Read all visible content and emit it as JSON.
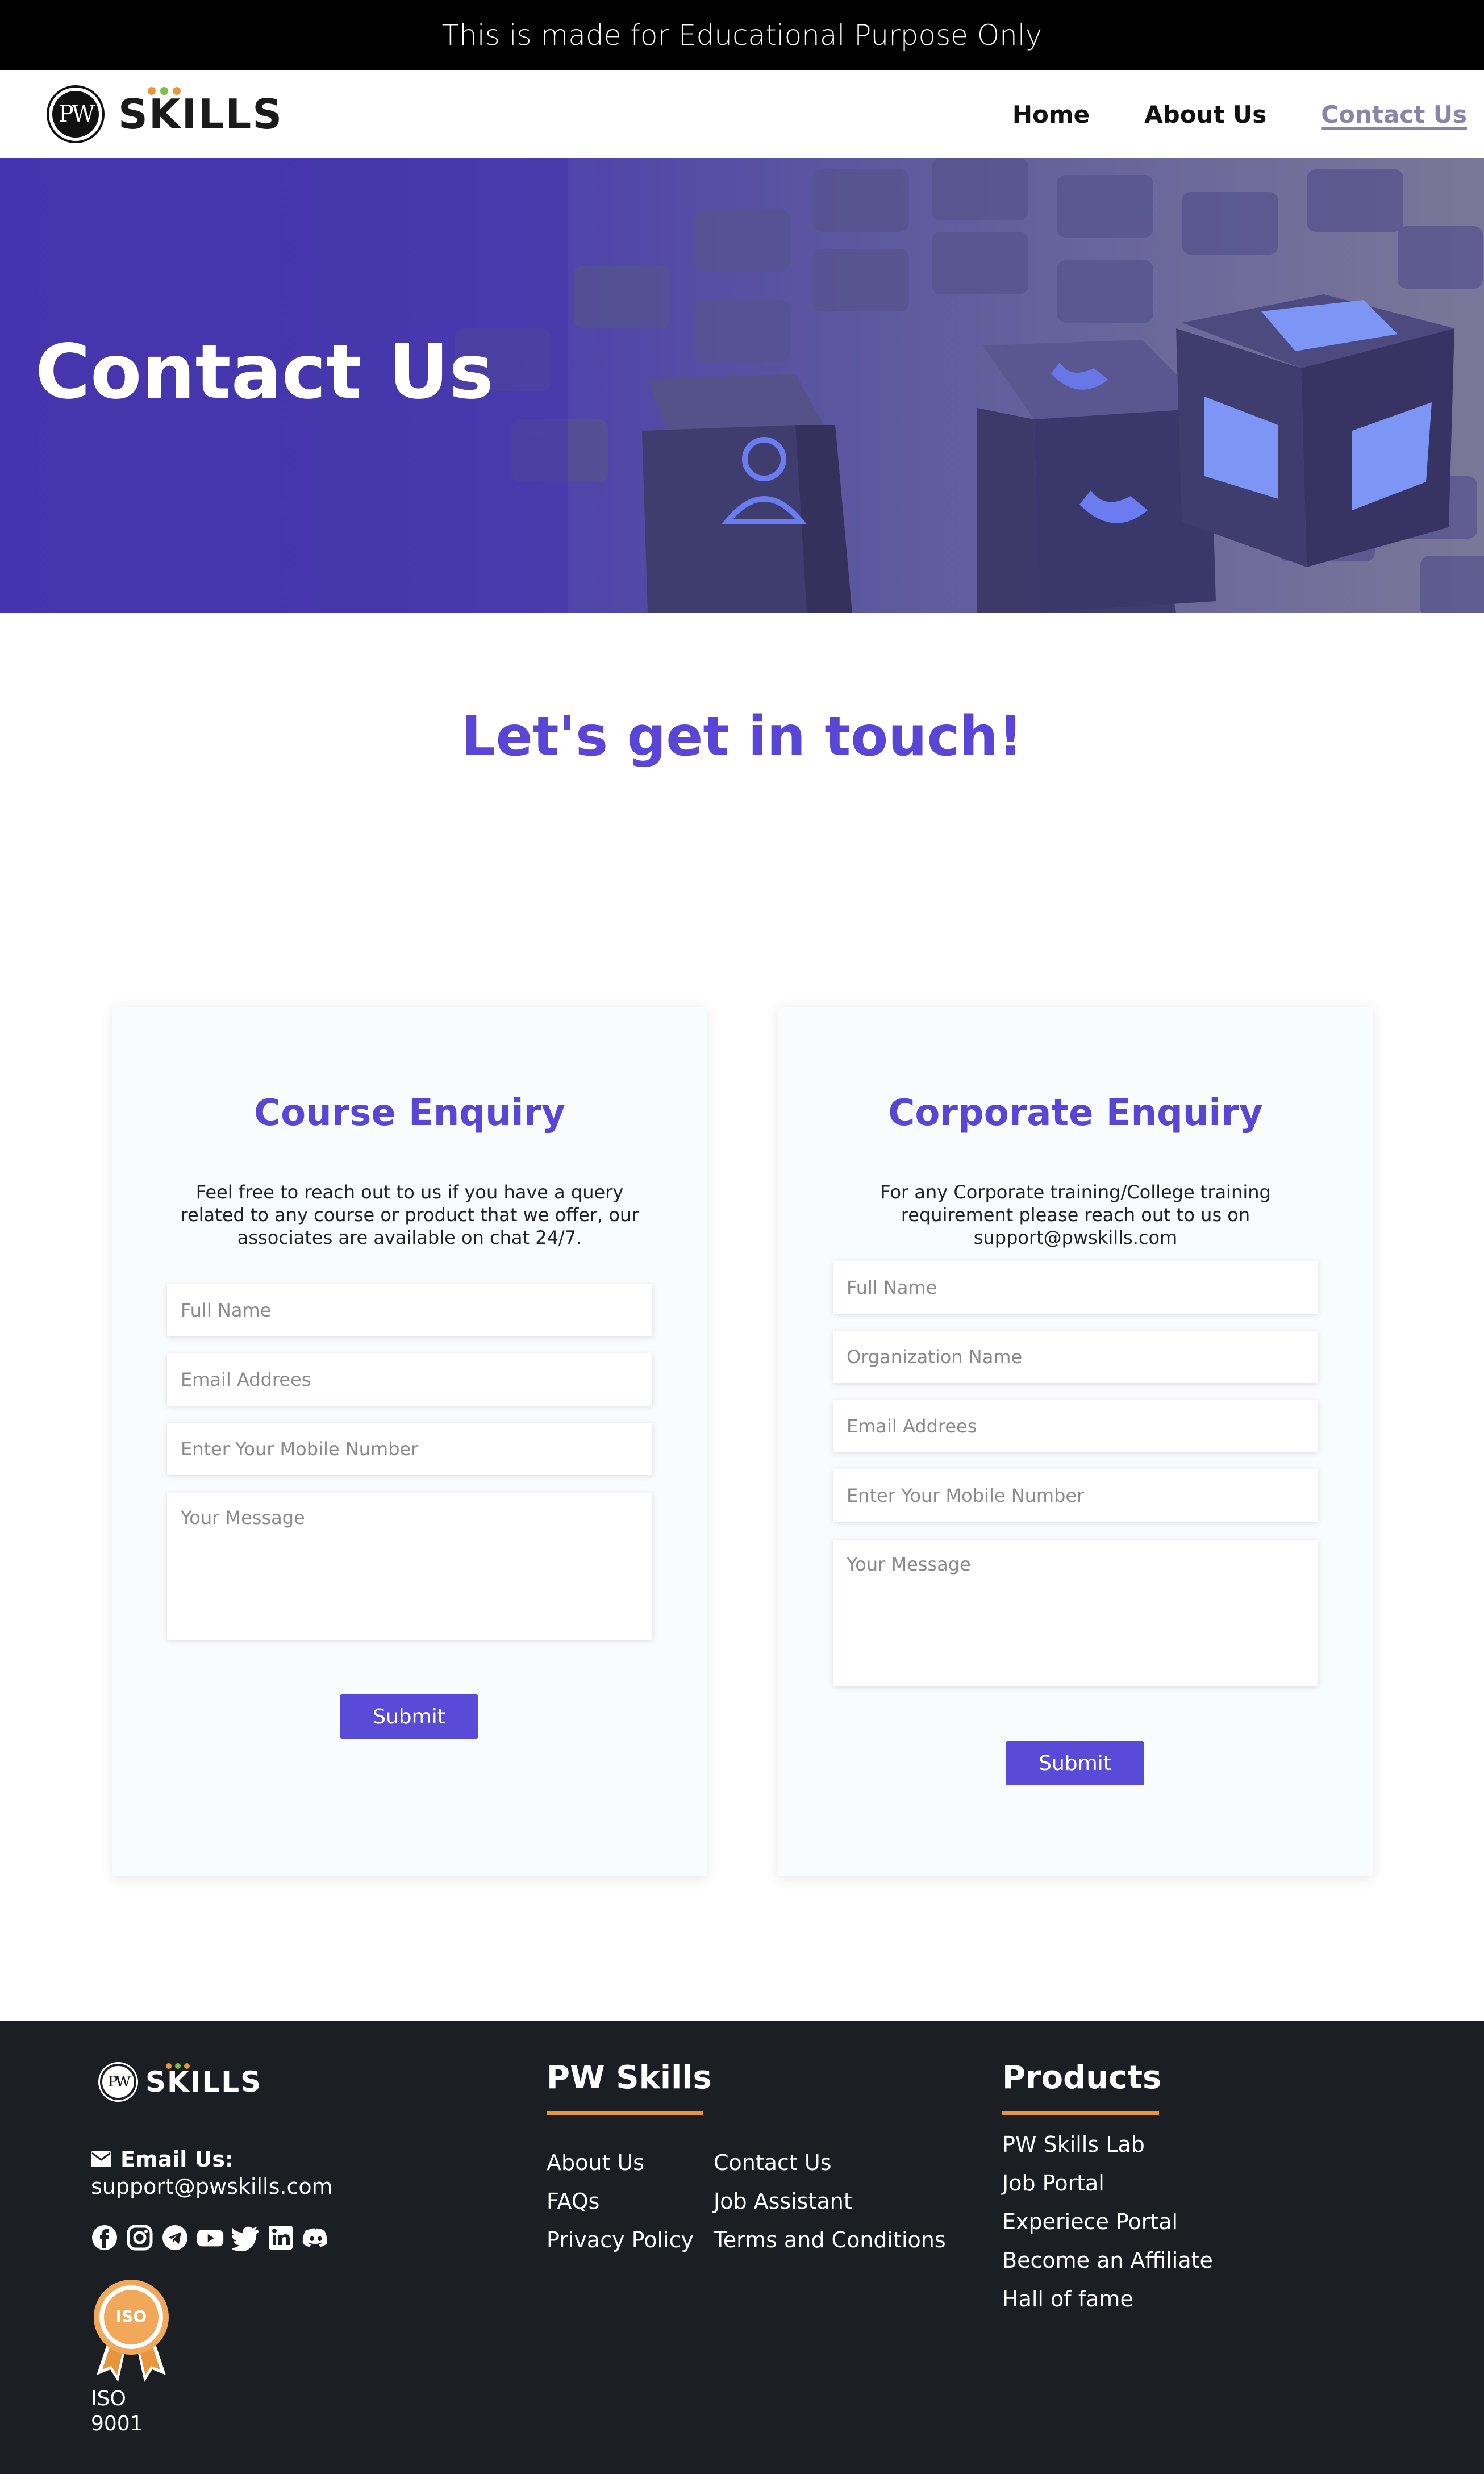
{
  "banner": {
    "text": "This is made for Educational Purpose Only"
  },
  "brand": {
    "monogram": "PW",
    "word": "SKILLS",
    "dot_colors": [
      "#e8963d",
      "#7bc043",
      "#e8963d"
    ]
  },
  "nav": {
    "items": [
      {
        "label": "Home",
        "active": false
      },
      {
        "label": "About Us",
        "active": false
      },
      {
        "label": "Contact Us",
        "active": true
      }
    ]
  },
  "hero": {
    "title": "Contact Us"
  },
  "touch": {
    "heading": "Let's get in touch!"
  },
  "course_enquiry": {
    "title": "Course Enquiry",
    "description": "Feel free to reach out to us if you have a query related to any course or product that we offer, our associates are available on chat 24/7.",
    "fields": {
      "full_name": "Full Name",
      "email": "Email Addrees",
      "mobile": "Enter Your Mobile Number",
      "message": "Your Message"
    },
    "submit_label": "Submit"
  },
  "corporate_enquiry": {
    "title": "Corporate Enquiry",
    "description": "For any Corporate training/College training requirement please reach out to us on support@pwskills.com",
    "fields": {
      "full_name": "Full Name",
      "organization": "Organization Name",
      "email": "Email Addrees",
      "mobile": "Enter Your Mobile Number",
      "message": "Your Message"
    },
    "submit_label": "Submit"
  },
  "footer": {
    "email_label": "Email Us:",
    "email_value": "support@pwskills.com",
    "socials": [
      "facebook-icon",
      "instagram-icon",
      "telegram-icon",
      "youtube-icon",
      "twitter-icon",
      "linkedin-icon",
      "discord-icon"
    ],
    "iso": {
      "badge_text": "ISO",
      "line1": "ISO",
      "line2": "9001"
    },
    "pw_skills": {
      "title": "PW Skills",
      "links": [
        "About Us",
        "Contact Us",
        "FAQs",
        "Job Assistant",
        "Privacy Policy",
        "Terms and Conditions"
      ]
    },
    "products": {
      "title": "Products",
      "links": [
        "PW Skills Lab",
        "Job Portal",
        "Experiece Portal",
        "Become an Affiliate",
        "Hall of fame"
      ]
    }
  },
  "colors": {
    "accent": "#5a46d6",
    "button": "#5a4ad8",
    "footer_bg": "#1b1f23",
    "footer_bar": "#e8963d",
    "hero_bg": "#4b3ab0"
  }
}
